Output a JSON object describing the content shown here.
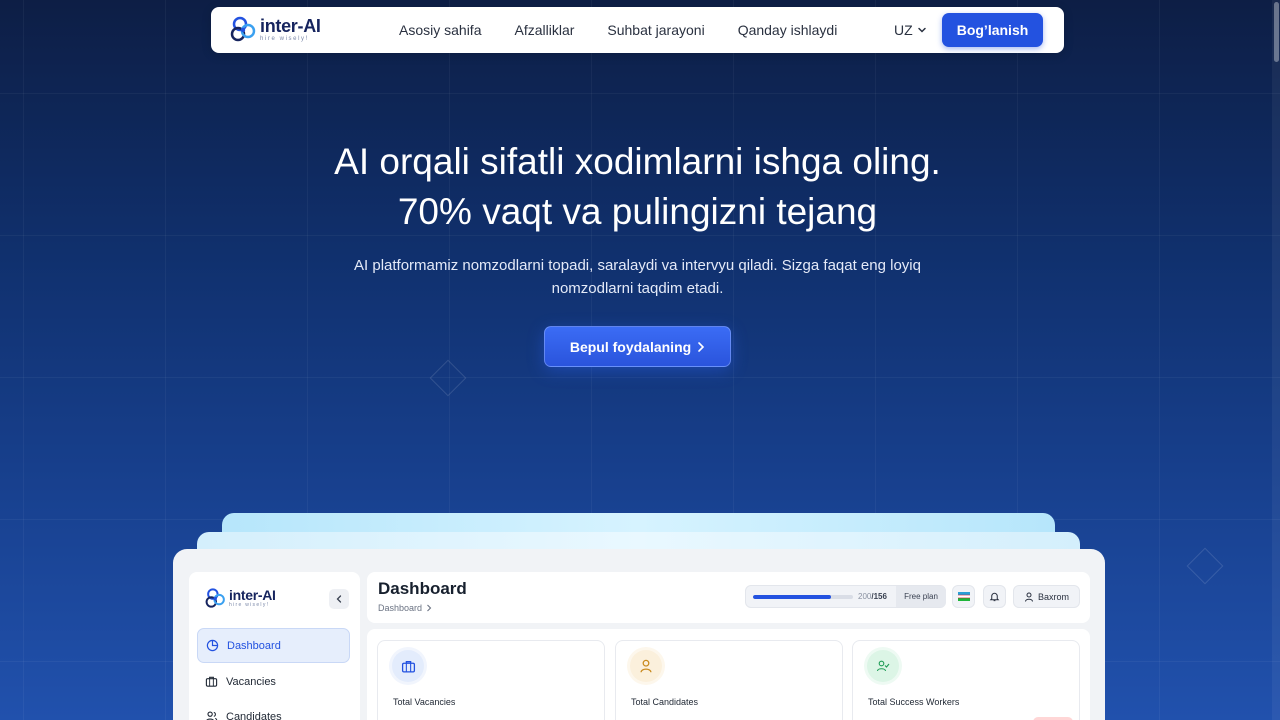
{
  "brand": {
    "name": "inter-AI",
    "tagline": "hire wisely!"
  },
  "nav": {
    "links": [
      "Asosiy sahifa",
      "Afzalliklar",
      "Suhbat jarayoni",
      "Qanday ishlaydi"
    ],
    "language": "UZ",
    "contact_label": "Bog’lanish"
  },
  "hero": {
    "title_line1": "AI orqali sifatli xodimlarni ishga oling.",
    "title_line2": "70% vaqt va pulingizni tejang",
    "subtitle_line1": "AI platformamiz nomzodlarni topadi, saralaydi va intervyu qiladi. Sizga faqat eng loyiq",
    "subtitle_line2": "nomzodlarni taqdim etadi.",
    "cta_label": "Bepul foydalaning"
  },
  "dashboard": {
    "brand_name": "inter-AI",
    "brand_tagline": "hire wisely!",
    "sidebar": {
      "items": [
        {
          "label": "Dashboard",
          "icon": "pie-chart-icon",
          "active": true
        },
        {
          "label": "Vacancies",
          "icon": "briefcase-icon",
          "active": false
        },
        {
          "label": "Candidates",
          "icon": "users-icon",
          "active": false
        }
      ]
    },
    "header": {
      "title": "Dashboard",
      "breadcrumb": "Dashboard",
      "usage_used": "200",
      "usage_total": "/156",
      "usage_fraction": 0.78,
      "plan": "Free plan",
      "user": "Baxrom"
    },
    "stats": [
      {
        "label": "Total Vacancies",
        "icon": "briefcase-icon",
        "color": "#2352e0",
        "bg": "#e3ecfc"
      },
      {
        "label": "Total Candidates",
        "icon": "user-icon",
        "color": "#c98a1e",
        "bg": "#fbf0dc"
      },
      {
        "label": "Total Success Workers",
        "icon": "user-check-icon",
        "color": "#1e9c55",
        "bg": "#dcf5e6"
      }
    ]
  },
  "colors": {
    "accent": "#2352e0",
    "bg_top": "#0d1e45",
    "bg_bottom": "#2151ad"
  }
}
